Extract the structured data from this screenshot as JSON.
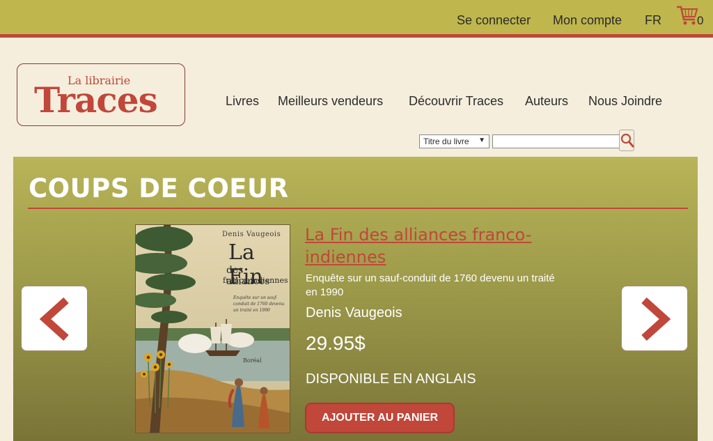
{
  "topbar": {
    "login": "Se connecter",
    "account": "Mon compte",
    "language": "FR",
    "cart_count": "0"
  },
  "logo": {
    "line1": "La librairie",
    "line2": "Traces"
  },
  "nav": {
    "items": [
      "Livres",
      "Meilleurs vendeurs",
      "Découvrir Traces",
      "Auteurs",
      "Nous Joindre"
    ]
  },
  "search": {
    "field_option": "Titre du livre",
    "query": ""
  },
  "featured": {
    "heading": "COUPS DE COEUR",
    "book": {
      "title": "La Fin des alliances franco-indiennes",
      "subtitle": "Enquête sur un sauf-conduit de 1760 devenu un traité en 1990",
      "author": "Denis Vaugeois",
      "price": "29.95$",
      "availability": "DISPONIBLE EN ANGLAIS",
      "add_button": "AJOUTER AU PANIER",
      "cover": {
        "author": "Denis Vaugeois",
        "title_line1": "La Fin",
        "title_line2": "des alliances",
        "title_line3": "franco-indiennes",
        "subtitle": "Enquête sur un sauf-conduit de 1760 devenu un traité en 1990",
        "publisher": "Boréal"
      }
    }
  },
  "colors": {
    "topbar": "#bfb64d",
    "accent": "#c0473a",
    "background": "#f5eedd",
    "panel": "#9d9a4a"
  }
}
